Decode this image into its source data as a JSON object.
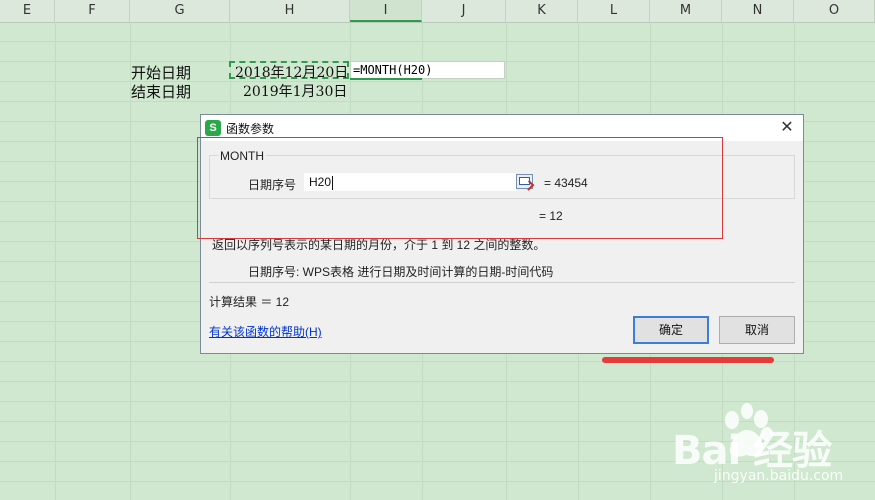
{
  "sheet": {
    "columns": [
      "E",
      "F",
      "G",
      "H",
      "I",
      "J",
      "K",
      "L",
      "M",
      "N",
      "O"
    ],
    "active_column": "I",
    "cells": {
      "start_label": "开始日期",
      "end_label": "结束日期",
      "start_value": "2018年12月20日",
      "end_value": "2019年1月30日",
      "formula": "=MONTH(H20)"
    }
  },
  "dialog": {
    "title": "函数参数",
    "app_icon_letter": "S",
    "close_glyph": "✕",
    "function_name": "MONTH",
    "arg_label": "日期序号",
    "arg_input_value": "H20",
    "arg_value": "= 43454",
    "result_value": "= 12",
    "description": "返回以序列号表示的某日期的月份，介于 1 到 12 之间的整数。",
    "param_description": "日期序号:   WPS表格 进行日期及时间计算的日期-时间代码",
    "calc_result": "计算结果 ＝ 12",
    "help_link": "有关该函数的帮助(H)",
    "ok_label": "确定",
    "cancel_label": "取消"
  },
  "watermark": {
    "logo": "Bai  经验",
    "url": "jingyan.baidu.com"
  },
  "colors": {
    "sheet_bg": "#cfe8cf",
    "selection": "#2e9b4f",
    "annotation_red": "#d9383a",
    "link": "#0033cc",
    "ok_border": "#3b7dd8"
  }
}
